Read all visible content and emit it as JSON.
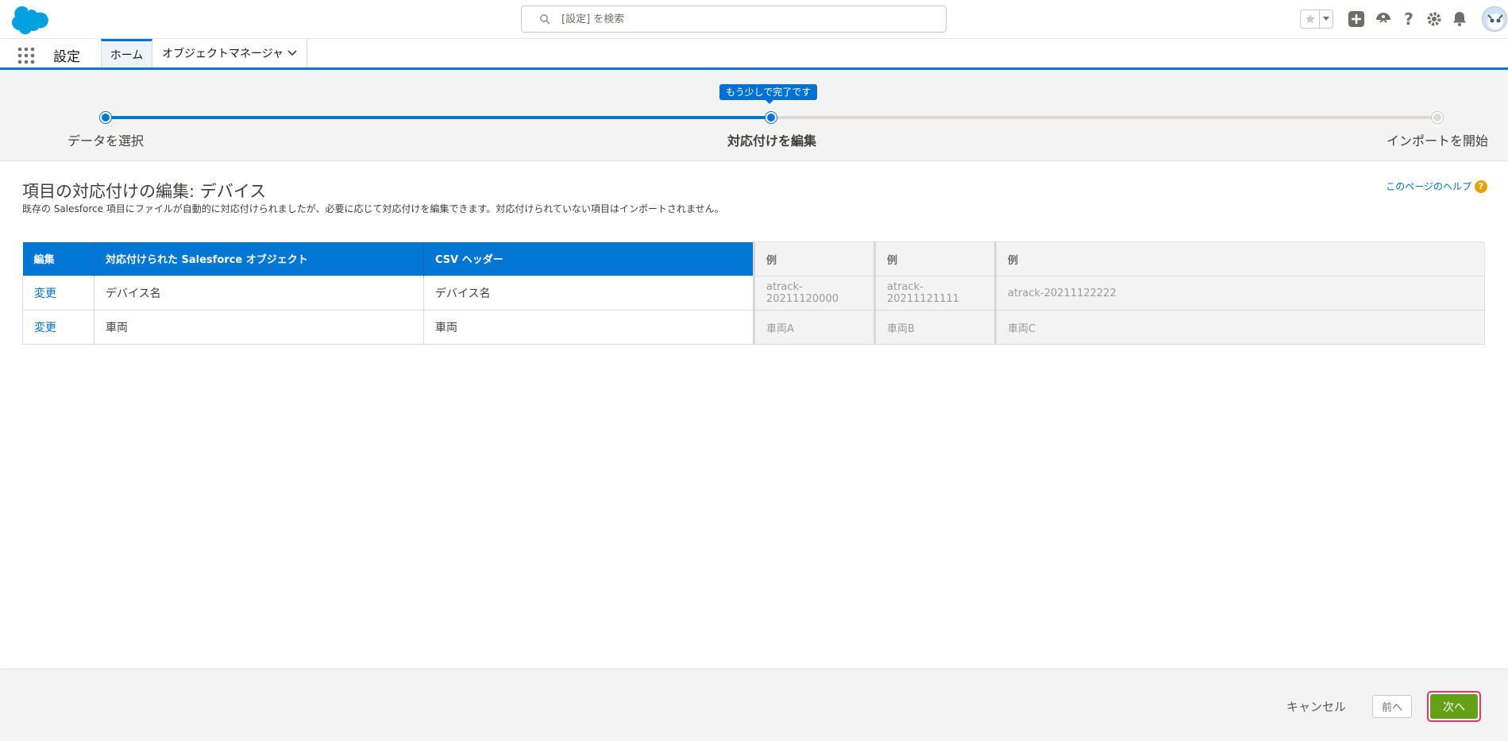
{
  "header": {
    "search_placeholder": "[設定] を検索"
  },
  "context": {
    "app_name": "設定",
    "tabs": [
      {
        "label": "ホーム"
      },
      {
        "label": "オブジェクトマネージャ"
      }
    ]
  },
  "progress": {
    "tooltip": "もう少しで完了です",
    "steps": [
      {
        "label": "データを選択",
        "state": "done"
      },
      {
        "label": "対応付けを編集",
        "state": "current"
      },
      {
        "label": "インポートを開始",
        "state": "todo"
      }
    ]
  },
  "page": {
    "title": "項目の対応付けの編集: デバイス",
    "description": "既存の Salesforce 項目にファイルが自動的に対応付けられましたが、必要に応じて対応付けを編集できます。対応付けられていない項目はインポートされません。",
    "help_link": "このページのヘルプ",
    "help_icon": "?"
  },
  "table": {
    "headers": [
      "編集",
      "対応付けられた Salesforce オブジェクト",
      "CSV ヘッダー",
      "例",
      "例",
      "例"
    ],
    "rows": [
      [
        "変更",
        "デバイス名",
        "デバイス名",
        "atrack-20211120000",
        "atrack-20211121111",
        "atrack-20211122222"
      ],
      [
        "変更",
        "車両",
        "車両",
        "車両A",
        "車両B",
        "車両C"
      ]
    ]
  },
  "footer": {
    "cancel": "キャンセル",
    "prev": "前へ",
    "next": "次へ"
  },
  "colors": {
    "brand_blue": "#0176d3",
    "next_green": "#64a118",
    "highlight": "#e8336d"
  }
}
